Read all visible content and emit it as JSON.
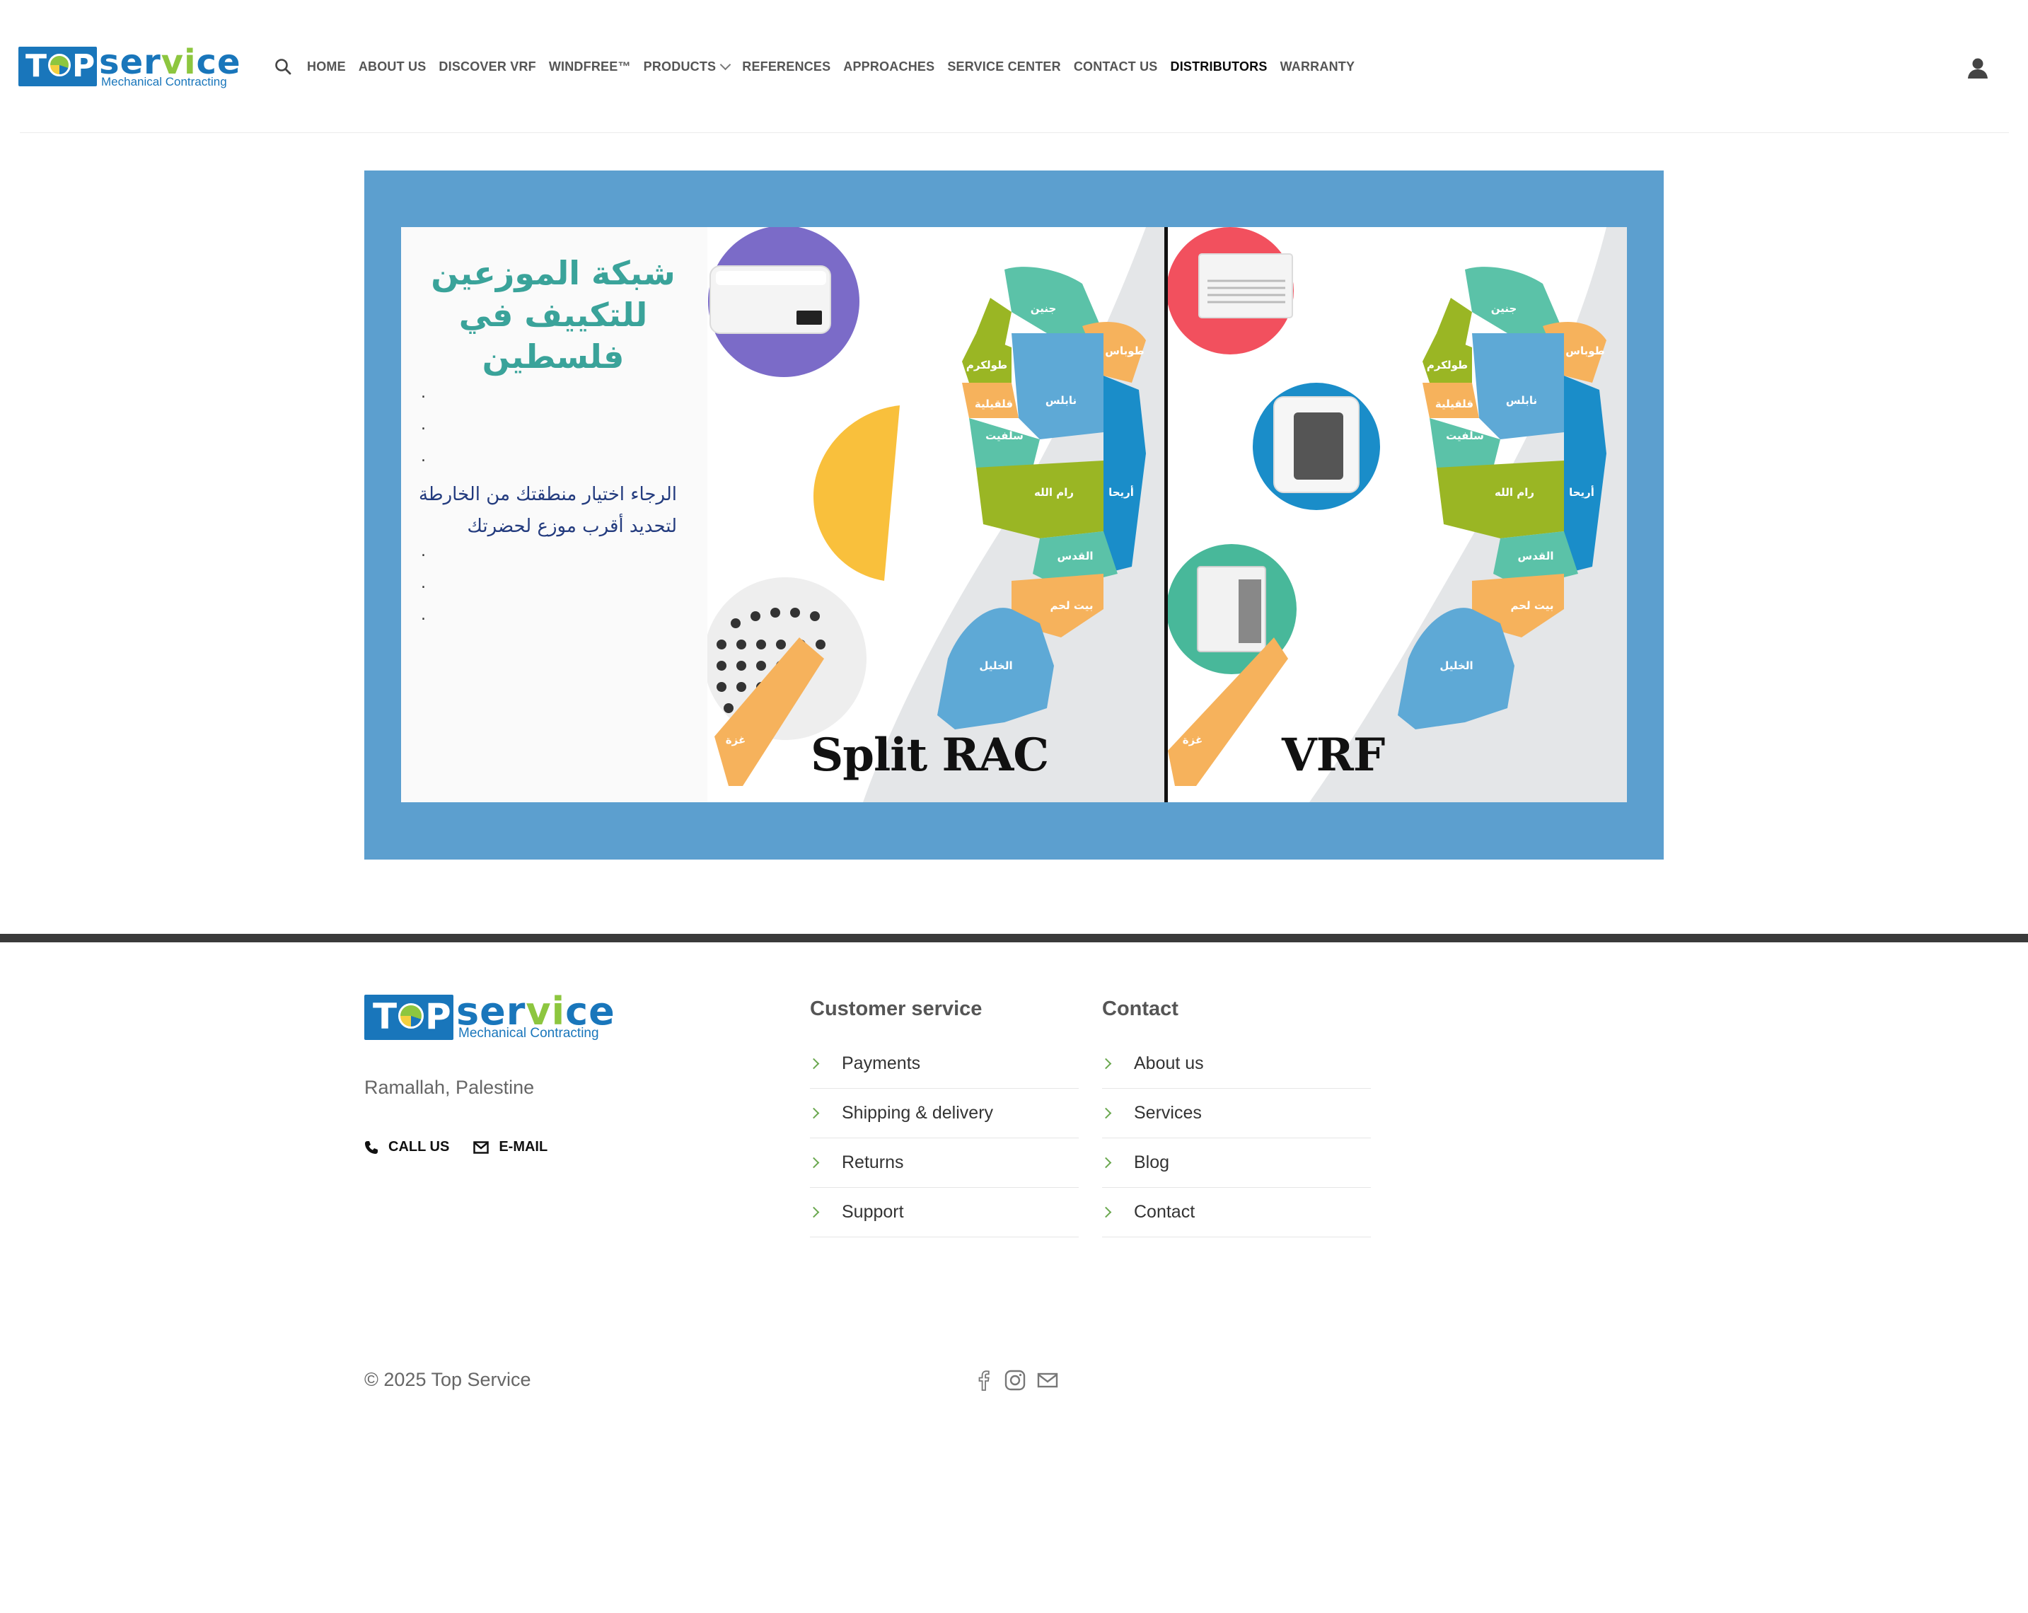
{
  "brand": {
    "logo_top": "TOP",
    "logo_service": "service",
    "logo_sub": "Mechanical Contracting"
  },
  "nav": {
    "items": [
      "HOME",
      "ABOUT US",
      "DISCOVER VRF",
      "WINDFREE™",
      "PRODUCTS",
      "REFERENCES",
      "APPROACHES",
      "SERVICE CENTER",
      "CONTACT US",
      "DISTRIBUTORS",
      "WARRANTY"
    ],
    "active": "DISTRIBUTORS"
  },
  "banner": {
    "title_line1": "شبكة الموزعين",
    "title_line2": "للتكييف في",
    "title_line3": "فلسطين",
    "dot": ".",
    "body_line1": "الرجاء اختيار منطقتك من الخارطة",
    "body_line2": "لتحديد أقرب موزع لحضرتك",
    "caption_left": "Split RAC",
    "caption_right": "VRF",
    "regions": [
      {
        "ar": "جنين",
        "en": "Jenin"
      },
      {
        "ar": "طوباس",
        "en": "Tubas"
      },
      {
        "ar": "طولكرم",
        "en": "Tulkarm"
      },
      {
        "ar": "قلقيلية",
        "en": "Qalqilya"
      },
      {
        "ar": "نابلس",
        "en": "Nablus"
      },
      {
        "ar": "سلفيت",
        "en": "Salfit"
      },
      {
        "ar": "رام الله",
        "en": "Ramallah"
      },
      {
        "ar": "أريحا",
        "en": "Jericho"
      },
      {
        "ar": "القدس",
        "en": "Jerusalem"
      },
      {
        "ar": "بيت لحم",
        "en": "Bethlehem"
      },
      {
        "ar": "الخليل",
        "en": "Hebron"
      },
      {
        "ar": "غزة",
        "en": "Gaza"
      }
    ],
    "colors": {
      "frame": "#5c9fcf",
      "teal": "#5bc2a8",
      "orange": "#f6b25c",
      "blue": "#5ea9d6",
      "green": "#9ab624",
      "deepblue": "#1a8dc9",
      "title": "#3aa39a",
      "body": "#233b7e"
    }
  },
  "footer": {
    "location": "Ramallah, Palestine",
    "call_label": "CALL US",
    "email_label": "E-MAIL",
    "customer_service": {
      "heading": "Customer service",
      "links": [
        "Payments",
        "Shipping & delivery",
        "Returns",
        "Support"
      ]
    },
    "contact": {
      "heading": "Contact",
      "links": [
        "About us",
        "Services",
        "Blog",
        "Contact"
      ]
    },
    "copyright": "© 2025 Top Service",
    "socials": [
      "facebook-icon",
      "instagram-icon",
      "email-icon"
    ]
  }
}
